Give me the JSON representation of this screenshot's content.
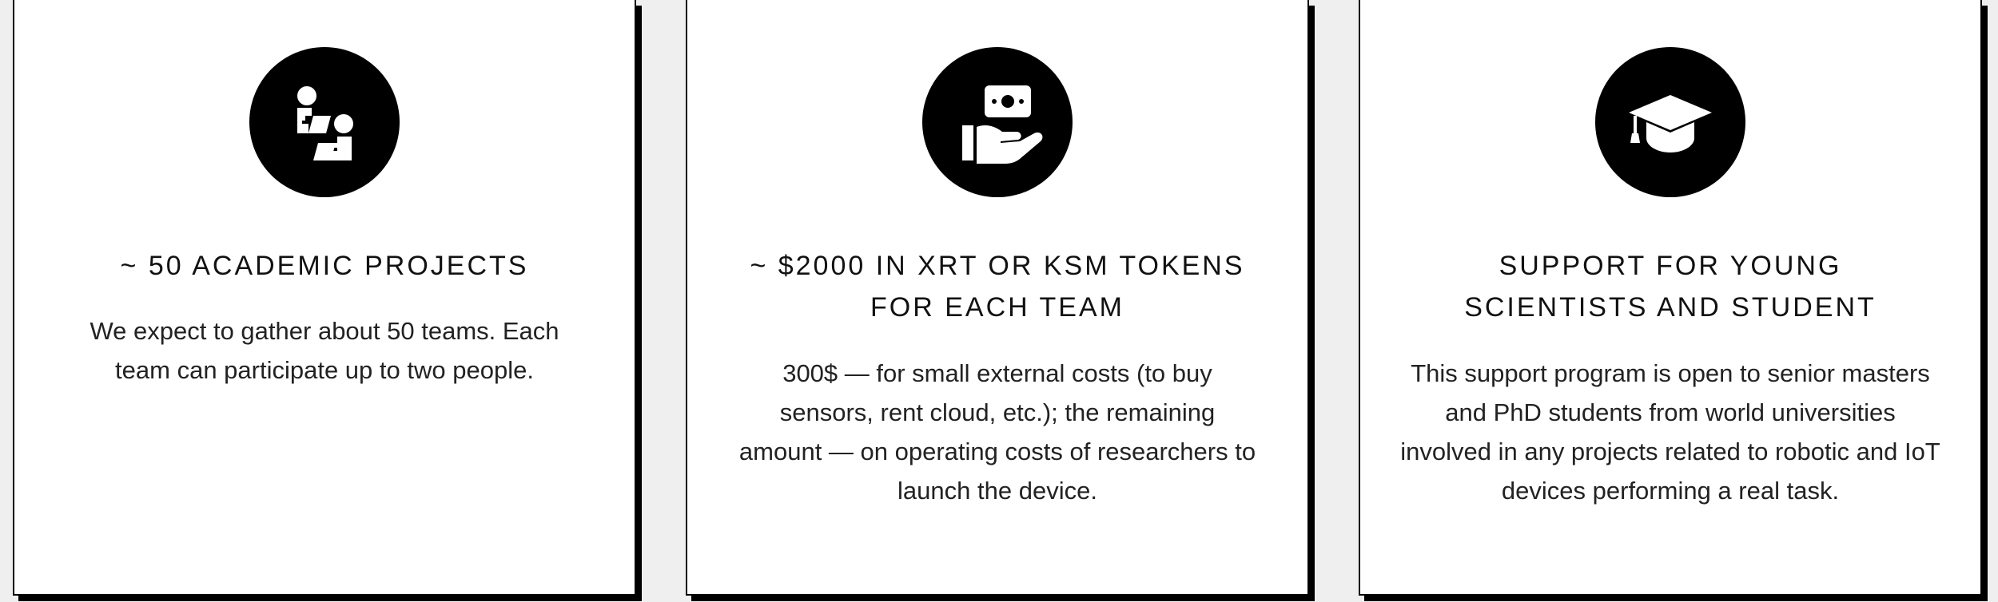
{
  "cards": [
    {
      "icon": "people-collaborating-icon",
      "title": "~ 50 ACADEMIC PROJECTS",
      "text": "We expect to gather about 50 teams. Each team can participate up to two people."
    },
    {
      "icon": "hand-holding-money-icon",
      "title": "~ $2000 IN XRT OR KSM TOKENS FOR EACH TEAM",
      "text": "300$ — for small external costs (to buy sensors, rent cloud, etc.); the remaining amount — on operating costs of researchers to launch the device."
    },
    {
      "icon": "graduation-cap-icon",
      "title": "SUPPORT FOR YOUNG SCIENTISTS AND STUDENT",
      "text": "This support program is open to senior masters and PhD students from world universities involved in any projects related to robotic and IoT devices performing a real task."
    }
  ],
  "colors": {
    "background": "#efefef",
    "card": "#ffffff",
    "accent": "#000000"
  }
}
